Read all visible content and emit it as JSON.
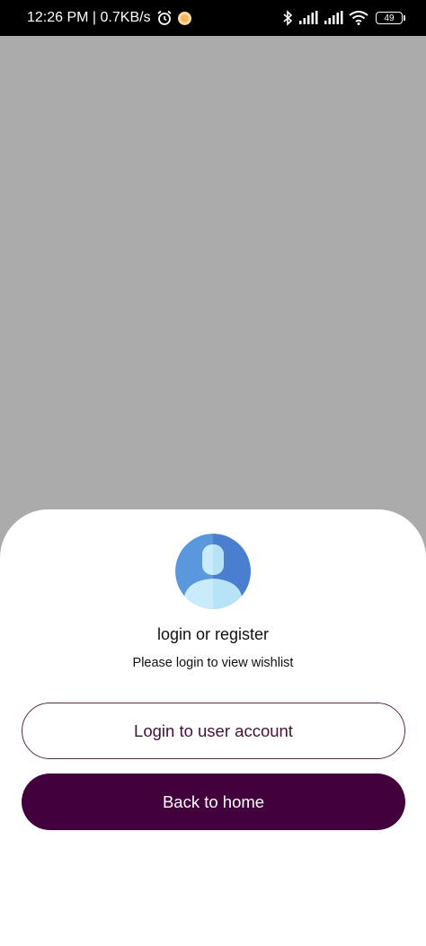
{
  "status_bar": {
    "time_speed": "12:26 PM | 0.7KB/s",
    "battery": "49",
    "icons": [
      "alarm-icon",
      "notification-dot-icon",
      "bluetooth-icon",
      "signal-icon",
      "signal-icon",
      "wifi-icon",
      "battery-icon"
    ]
  },
  "sheet": {
    "title": "login or register",
    "subtitle": "Please login to view wishlist",
    "login_button": "Login to user account",
    "home_button": "Back to home"
  },
  "colors": {
    "brand": "#42003c",
    "backdrop": "#ababab",
    "avatar_blue": "#4f86d4",
    "avatar_light": "#c9ecfb"
  }
}
